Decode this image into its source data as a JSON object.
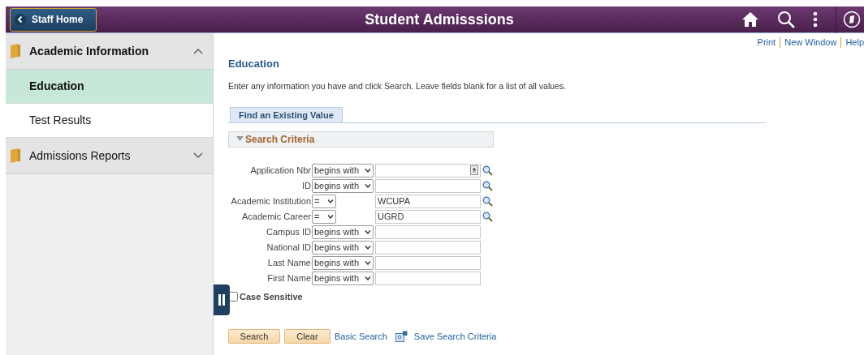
{
  "header": {
    "back_button": "Staff Home",
    "title": "Student Admisssions"
  },
  "sidebar": {
    "groups": [
      {
        "label": "Academic Information",
        "expanded": true,
        "children": [
          {
            "label": "Education",
            "selected": true
          },
          {
            "label": "Test Results",
            "selected": false
          }
        ]
      },
      {
        "label": "Admissions Reports",
        "expanded": false
      }
    ]
  },
  "top_links": [
    "Print",
    "New Window",
    "Help"
  ],
  "page_title": "Education",
  "instructions": "Enter any information you have and click Search. Leave fields blank for a list of all values.",
  "tabs": [
    {
      "label": "Find an Existing Value",
      "selected": true
    }
  ],
  "section": {
    "title": "Search Criteria",
    "expanded": true
  },
  "fields": [
    {
      "label": "Application Nbr",
      "operator": "begins with",
      "lookup": true,
      "prompt_icon": true
    },
    {
      "label": "ID",
      "operator": "begins with",
      "lookup": true,
      "prompt_icon": false
    },
    {
      "label": "Academic Institution",
      "operator": "=",
      "value": "WCUPA",
      "lookup": true,
      "prompt_icon": false
    },
    {
      "label": "Academic Career",
      "operator": "=",
      "value": "UGRD",
      "lookup": true,
      "prompt_icon": false
    },
    {
      "label": "Campus ID",
      "operator": "begins with",
      "lookup": false,
      "prompt_icon": false
    },
    {
      "label": "National ID",
      "operator": "begins with",
      "lookup": false,
      "prompt_icon": false
    },
    {
      "label": "Last Name",
      "operator": "begins with",
      "lookup": false,
      "prompt_icon": false
    },
    {
      "label": "First Name",
      "operator": "begins with",
      "lookup": false,
      "prompt_icon": false
    }
  ],
  "case_sensitive": {
    "label": "Case Sensitive",
    "checked": false
  },
  "buttons": [
    "Search",
    "Clear"
  ],
  "links": [
    "Basic Search",
    "Save Search Criteria"
  ]
}
